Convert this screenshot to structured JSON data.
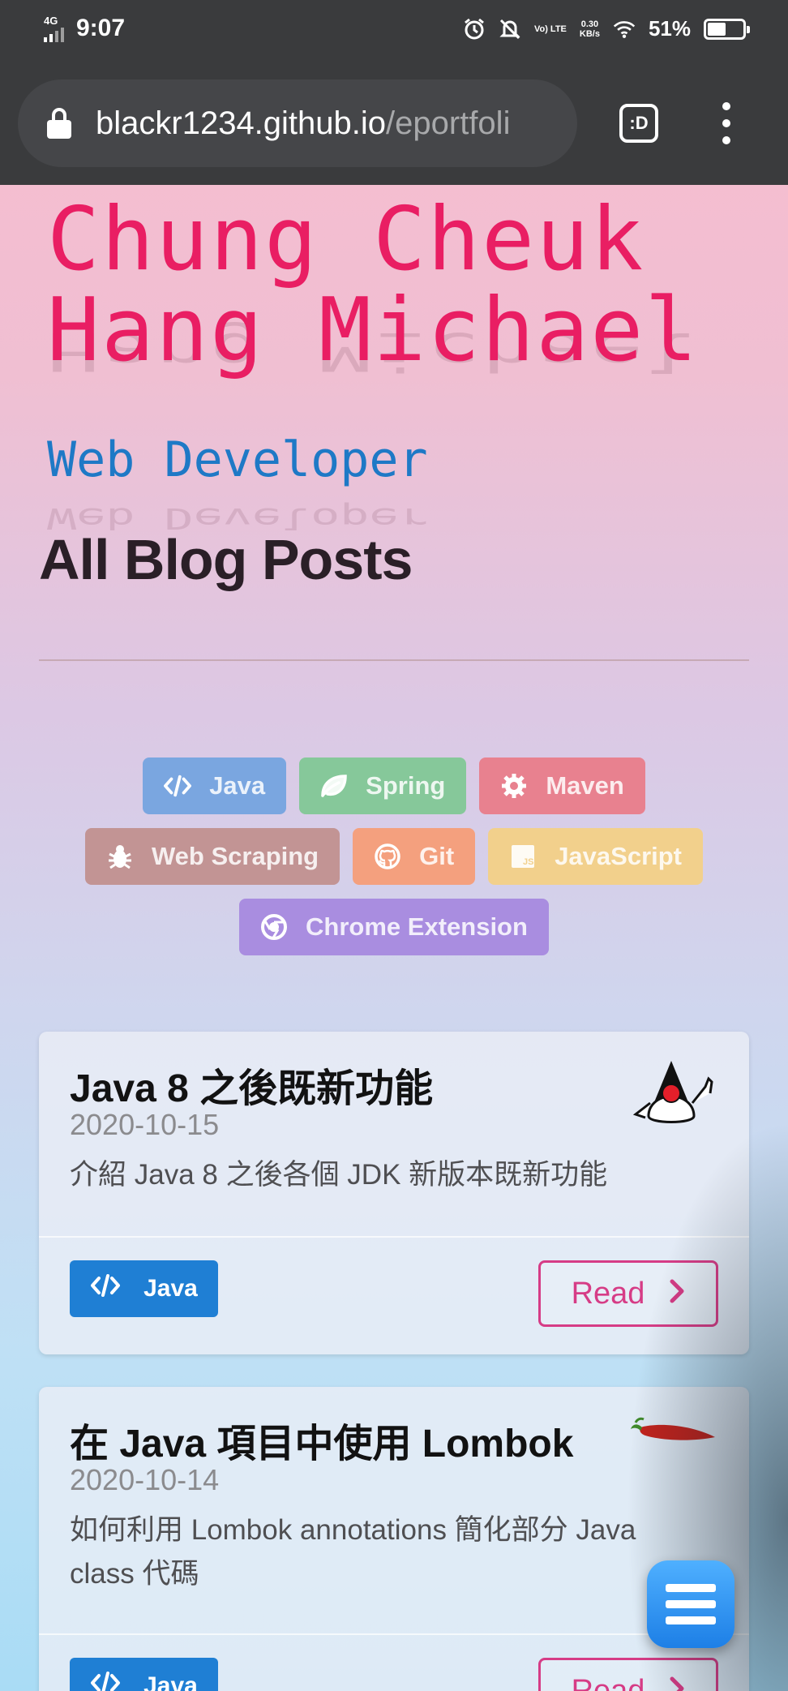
{
  "status_bar": {
    "network": "4G",
    "time": "9:07",
    "volte": "Vo) LTE",
    "speed_value": "0.30",
    "speed_unit": "KB/s",
    "battery": "51%"
  },
  "browser": {
    "url_domain": "blackr1234.github.io",
    "url_path": "/eportfoli",
    "tabs_label": ":D"
  },
  "hero": {
    "name_line1": "Chung Cheuk",
    "name_line2": "Hang Michael",
    "role": "Web Developer",
    "reflection_text": "Hang Michael",
    "reflection_role": "Web Developer",
    "page_title": "All Blog Posts"
  },
  "tags": [
    {
      "label": "Java",
      "icon": "code-icon",
      "color": "#7aa6e0"
    },
    {
      "label": "Spring",
      "icon": "leaf-icon",
      "color": "#86c89a"
    },
    {
      "label": "Maven",
      "icon": "gear-icon",
      "color": "#e8818f"
    },
    {
      "label": "Web Scraping",
      "icon": "bug-icon",
      "color": "#c29494"
    },
    {
      "label": "Git",
      "icon": "github-icon",
      "color": "#f4a07e"
    },
    {
      "label": "JavaScript",
      "icon": "js-icon",
      "color": "#f2d08c"
    },
    {
      "label": "Chrome Extension",
      "icon": "chrome-icon",
      "color": "#a98de0"
    }
  ],
  "posts": [
    {
      "title": "Java 8 之後既新功能",
      "date": "2020-10-15",
      "description": "介紹 Java 8 之後各個 JDK 新版本既新功能",
      "tag": "Java",
      "read_label": "Read",
      "image": "duke-mascot-icon"
    },
    {
      "title": "在 Java 項目中使用 Lombok",
      "date": "2020-10-14",
      "description": "如何利用 Lombok annotations 簡化部分 Java class 代碼",
      "tag": "Java",
      "read_label": "Read",
      "image": "chili-pepper-icon"
    }
  ],
  "colors": {
    "accent_pink": "#e91e63",
    "role_blue": "#1e79c6",
    "java_blue": "#1f7fd4",
    "read_pink": "#d63c86"
  }
}
